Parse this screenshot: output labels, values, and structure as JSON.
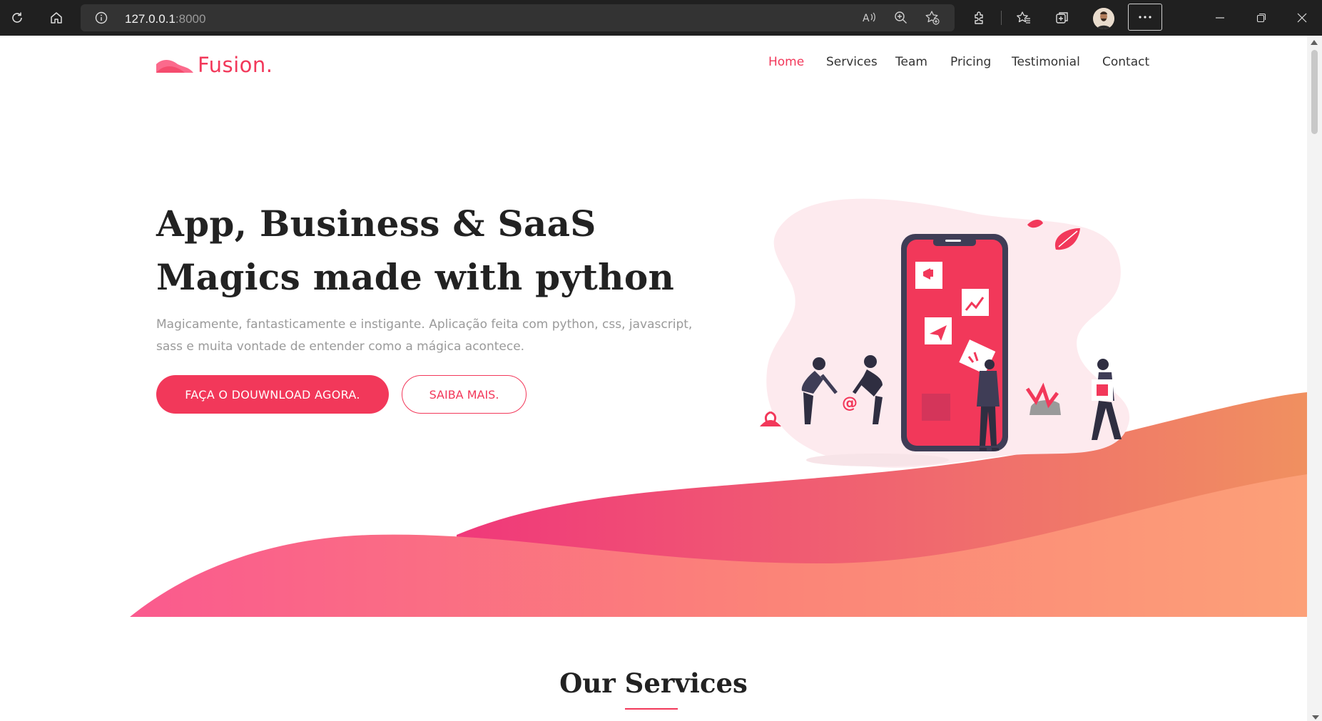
{
  "browser": {
    "url_host": "127.0.0.1",
    "url_port": ":8000",
    "icons": [
      "refresh-icon",
      "home-icon",
      "site-info-icon",
      "read-aloud-icon",
      "zoom-icon",
      "add-favorite-icon",
      "extensions-icon",
      "favorites-icon",
      "collections-icon",
      "profile-avatar",
      "more-icon",
      "minimize-icon",
      "restore-icon",
      "close-icon"
    ]
  },
  "site": {
    "logo_text": "Fusion.",
    "nav": [
      {
        "label": "Home",
        "active": true
      },
      {
        "label": "Services",
        "active": false
      },
      {
        "label": "Team",
        "active": false
      },
      {
        "label": "Pricing",
        "active": false
      },
      {
        "label": "Testimonial",
        "active": false
      },
      {
        "label": "Contact",
        "active": false
      }
    ]
  },
  "hero": {
    "title_line1": "App, Business & SaaS",
    "title_line2": "Magics made with python",
    "description": "Magicamente, fantasticamente e instigante. Aplicação feita com python, css, javascript, sass e muita vontade de entender como a mágica acontece.",
    "primary_button": "FAÇA O DOUWNLOAD AGORA.",
    "secondary_button": "SAIBA MAIS."
  },
  "services": {
    "title": "Our Services"
  },
  "colors": {
    "accent": "#f2385a",
    "chrome_bg": "#202020",
    "wave_pink": "#f74f86",
    "wave_orange": "#f9a07e"
  }
}
